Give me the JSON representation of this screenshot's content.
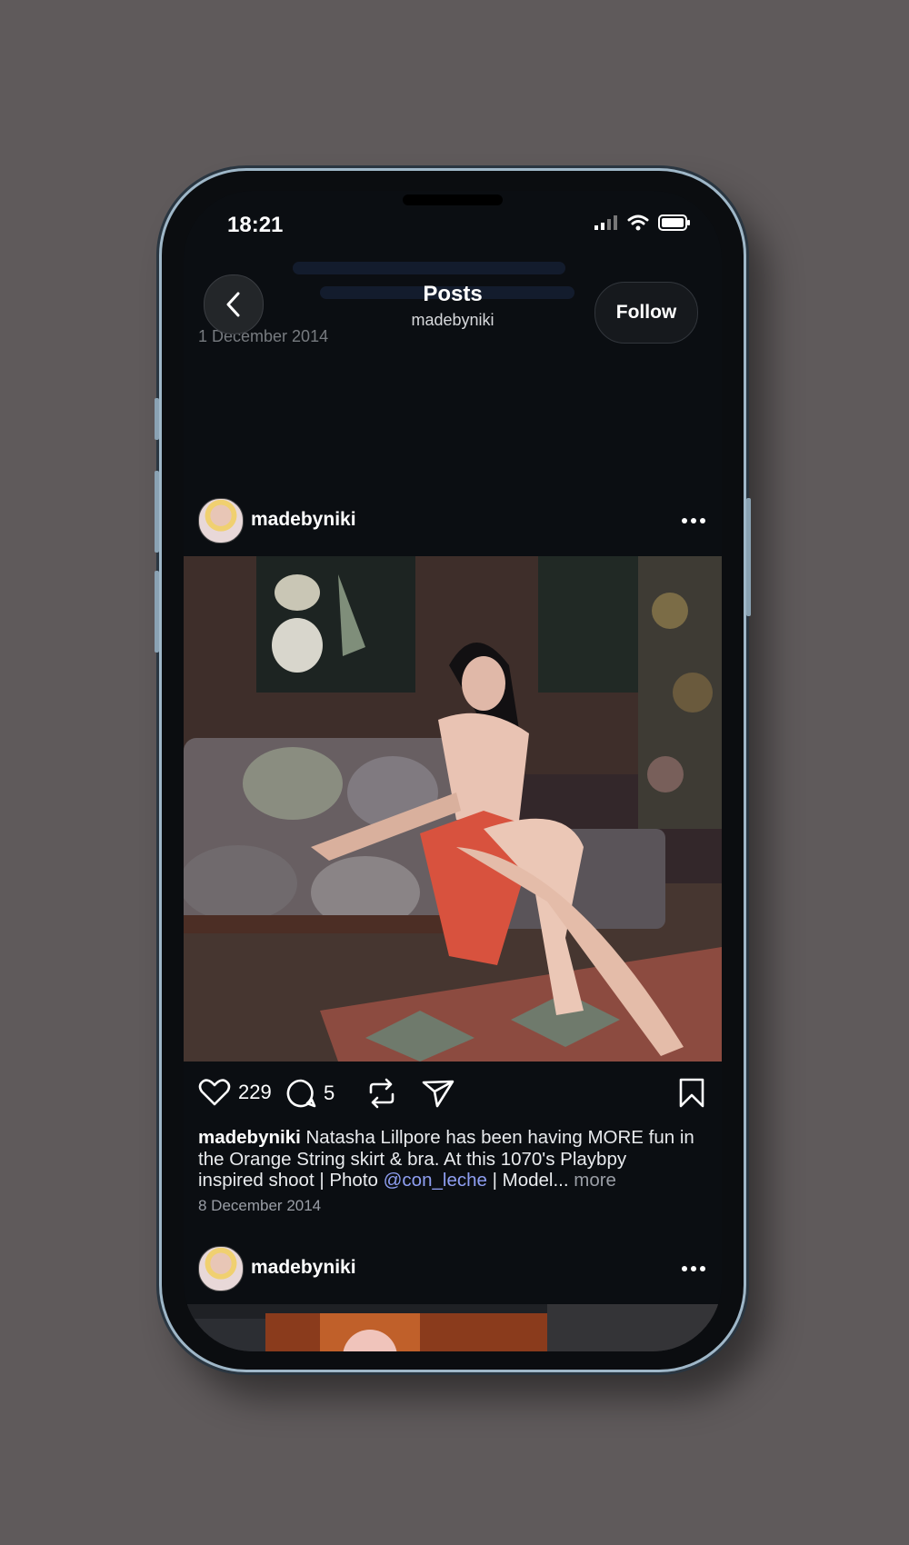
{
  "status_bar": {
    "time": "18:21"
  },
  "header": {
    "title": "Posts",
    "subtitle": "madebyniki",
    "follow_label": "Follow",
    "behind_date": "1 December 2014"
  },
  "posts": [
    {
      "username": "madebyniki",
      "likes": "229",
      "comments": "5",
      "caption_user": "madebyniki",
      "caption_text": " Natasha Lillpore has been having MORE fun in the Orange String skirt & bra. At this 1070's Playbpy inspired shoot | Photo ",
      "caption_mention": "@con_leche",
      "caption_rest": " | Model... ",
      "more_label": "more",
      "date": "8 December 2014"
    },
    {
      "username": "madebyniki"
    }
  ],
  "icons": {
    "back": "chevron-left-icon",
    "more": "ellipsis-icon",
    "like": "heart-icon",
    "comment": "comment-icon",
    "repost": "repost-icon",
    "share": "send-icon",
    "save": "bookmark-icon"
  },
  "colors": {
    "background": "#5f5a5b",
    "screen": "#0b0e12",
    "mention": "#8f9ff2"
  }
}
